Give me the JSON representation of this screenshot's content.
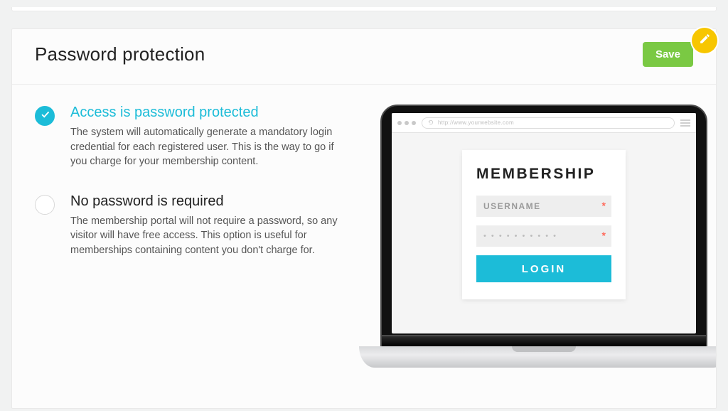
{
  "header": {
    "title": "Password protection",
    "save_label": "Save"
  },
  "options": [
    {
      "selected": true,
      "title": "Access is password protected",
      "desc": "The system will automatically generate a mandatory login credential for each registered user. This is the way to go if you charge for your membership content."
    },
    {
      "selected": false,
      "title": "No password is required",
      "desc": "The membership portal will not require a password, so any visitor will have free access. This option is useful for memberships containing content you don't charge for."
    }
  ],
  "illustration": {
    "url_text": "http://www.yourwebsite.com",
    "login_title": "MEMBERSHIP",
    "username_placeholder": "USERNAME",
    "password_mask": "• • • • • • • • • •",
    "login_button": "LOGIN",
    "required_mark": "*"
  }
}
